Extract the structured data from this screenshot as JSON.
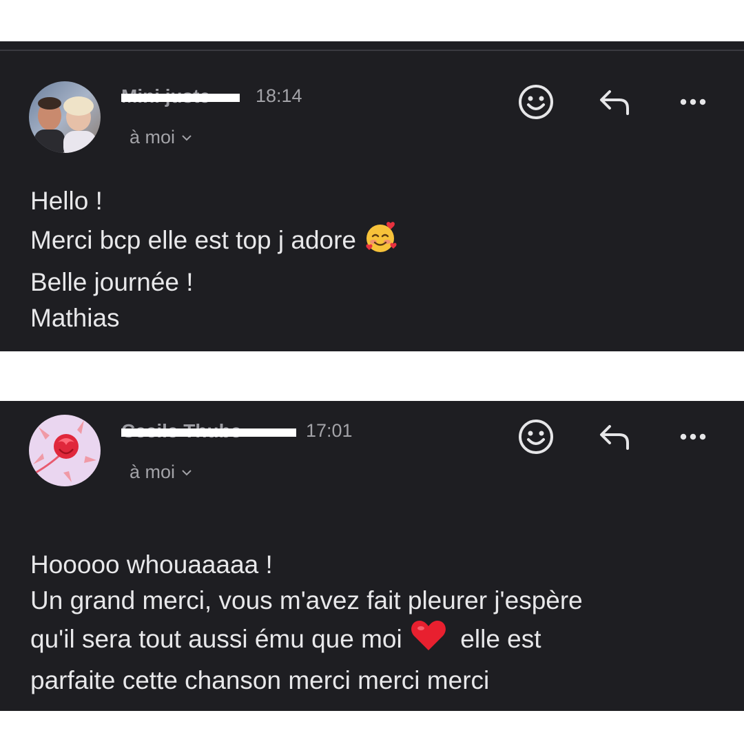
{
  "messages": [
    {
      "sender": "Mini juste",
      "time": "18:14",
      "to": "à moi",
      "lines": [
        {
          "text": "Hello !"
        },
        {
          "text": "Merci bcp elle est top j adore",
          "emoji": "smiling-face-with-hearts"
        },
        {
          "text": "Belle journée !"
        },
        {
          "text": "Mathias"
        }
      ]
    },
    {
      "sender": "Cecile Thube",
      "time": "17:01",
      "to": "à moi",
      "lines": [
        {
          "text": "Hooooo whouaaaaa !"
        },
        {
          "text": "Un grand merci, vous m'avez fait pleurer j'espère"
        },
        {
          "text": "qu'il sera tout aussi ému que moi",
          "emoji": "red-heart",
          "after": "elle est"
        },
        {
          "text": "parfaite cette chanson merci merci merci"
        }
      ]
    }
  ],
  "colors": {
    "card_background": "#1e1e22",
    "page_background": "#ffffff",
    "secondary_text": "#a3a3a8",
    "primary_text": "#e8e8ea",
    "redaction": "#ffffff"
  },
  "icons": [
    "emoji-reaction-icon",
    "reply-icon",
    "more-options-icon",
    "chevron-down-icon"
  ]
}
